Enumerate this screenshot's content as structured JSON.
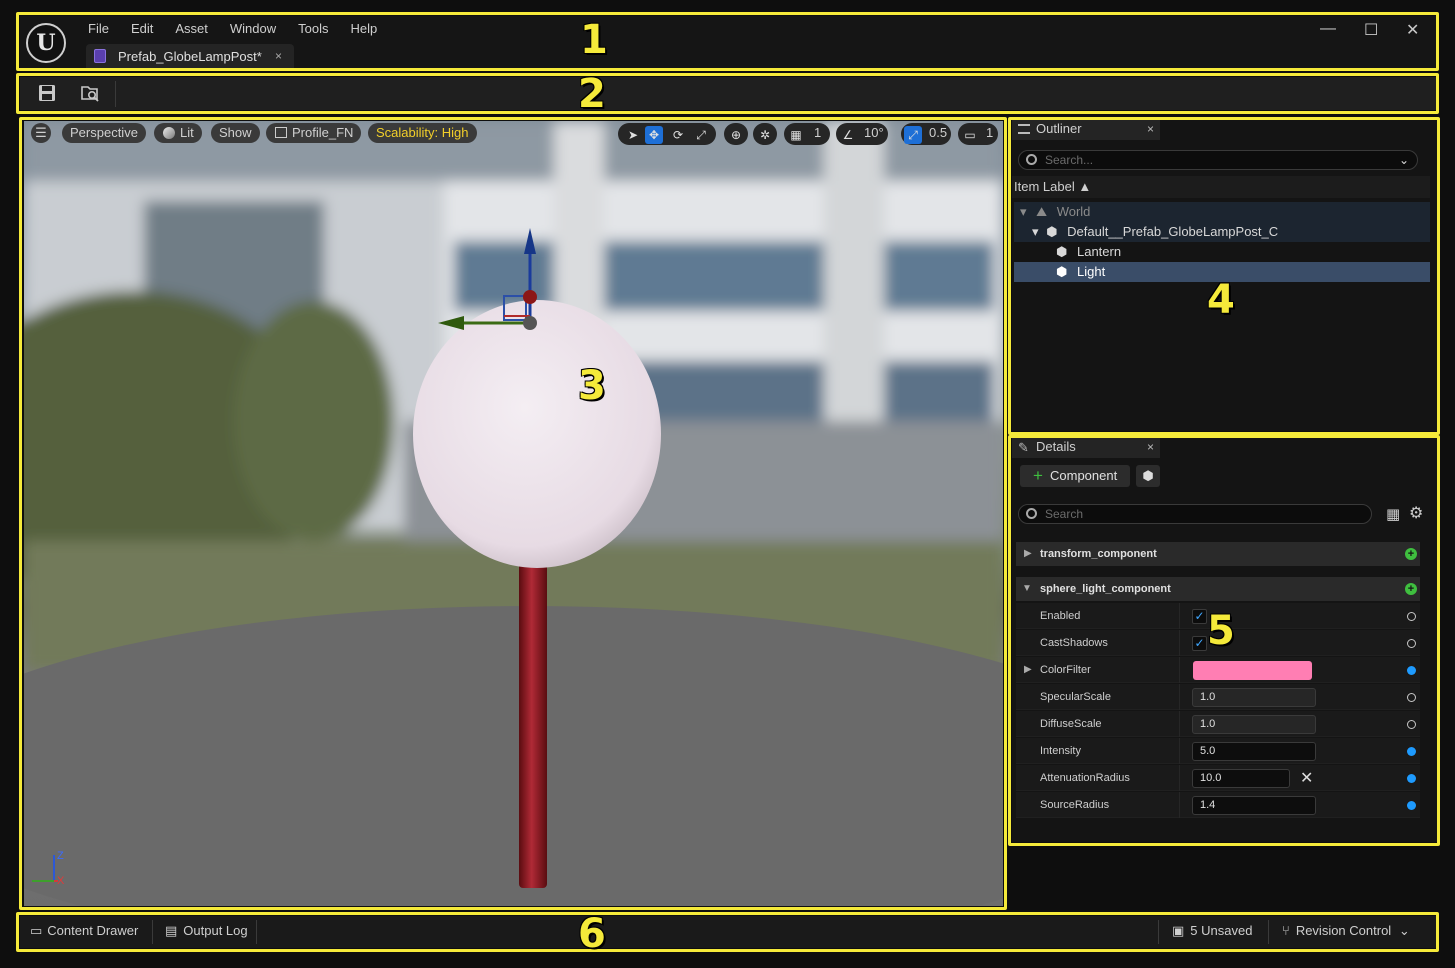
{
  "menu": [
    "File",
    "Edit",
    "Asset",
    "Window",
    "Tools",
    "Help"
  ],
  "logo_text": "U",
  "document_tab": {
    "title": "Prefab_GlobeLampPost*",
    "close": "×"
  },
  "window_controls": {
    "minimize": "—",
    "maximize": "☐",
    "close": "✕"
  },
  "toolbar": {
    "save_icon": "save-icon",
    "browse_icon": "browse-asset-icon"
  },
  "viewport": {
    "menu_icon": "☰",
    "perspective": "Perspective",
    "lit": "Lit",
    "show": "Show",
    "profile": "Profile_FN",
    "scalability": "Scalability: High",
    "grid_snap": "1",
    "rotation_snap": "10°",
    "scale_snap": "0.5",
    "camera_speed": "1",
    "axis_z": "Z",
    "axis_x": "X"
  },
  "outliner": {
    "tab": "Outliner",
    "close": "×",
    "search_placeholder": "Search...",
    "column_header": "Item Label ▲",
    "items": [
      {
        "label": "World",
        "level": 0,
        "expanded": true
      },
      {
        "label": "Default__Prefab_GlobeLampPost_C",
        "level": 1,
        "expanded": true
      },
      {
        "label": "Lantern",
        "level": 2
      },
      {
        "label": "Light",
        "level": 2,
        "selected": true
      }
    ]
  },
  "details": {
    "tab": "Details",
    "close": "×",
    "add_component": "Component",
    "search_placeholder": "Search",
    "sections": [
      {
        "name": "transform_component",
        "expanded": false
      },
      {
        "name": "sphere_light_component",
        "expanded": true
      }
    ],
    "properties": [
      {
        "label": "Enabled",
        "type": "checkbox",
        "value": "✓",
        "reset": "hollow"
      },
      {
        "label": "CastShadows",
        "type": "checkbox",
        "value": "✓",
        "reset": "hollow"
      },
      {
        "label": "ColorFilter",
        "type": "color",
        "value": "#ff7eb3",
        "reset": "blue"
      },
      {
        "label": "SpecularScale",
        "type": "number",
        "value": "1.0",
        "reset": "hollow"
      },
      {
        "label": "DiffuseScale",
        "type": "number",
        "value": "1.0",
        "reset": "hollow"
      },
      {
        "label": "Intensity",
        "type": "number",
        "value": "5.0",
        "reset": "blue"
      },
      {
        "label": "AttenuationRadius",
        "type": "number",
        "value": "10.0",
        "reset": "blue"
      },
      {
        "label": "SourceRadius",
        "type": "number",
        "value": "1.4",
        "reset": "blue"
      }
    ]
  },
  "statusbar": {
    "content_drawer": "Content Drawer",
    "output_log": "Output Log",
    "unsaved": "5 Unsaved",
    "revision_control": "Revision Control"
  },
  "annotations": [
    "1",
    "2",
    "3",
    "4",
    "5",
    "6"
  ],
  "colors": {
    "highlight_frame": "#f5ea3a",
    "selection": "#3a4d68",
    "color_filter": "#ff7eb3",
    "accent_blue": "#1e9bff"
  }
}
